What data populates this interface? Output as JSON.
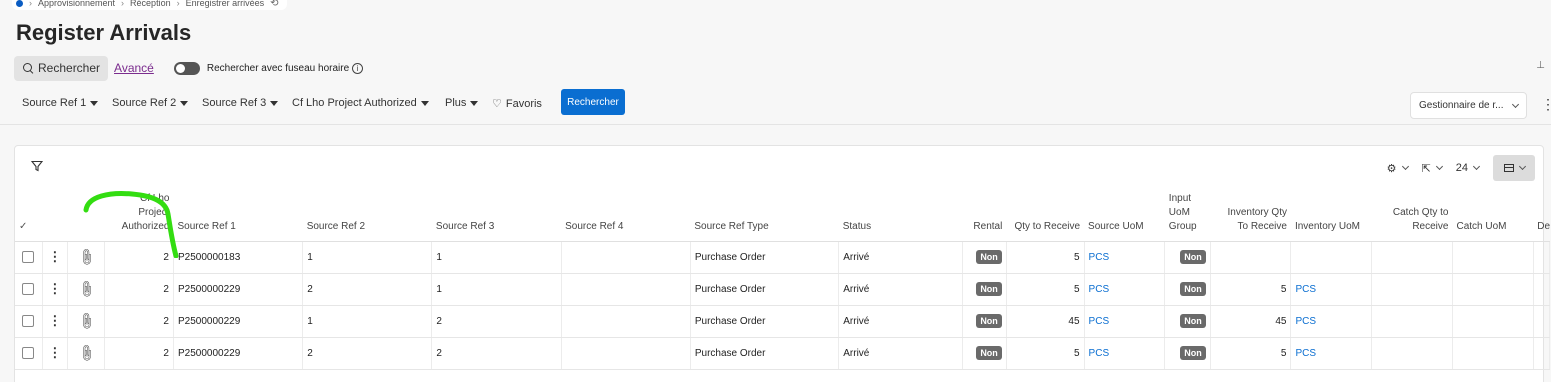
{
  "breadcrumb": {
    "items": [
      "Approvisionnement",
      "Réception",
      "Enregistrer arrivées"
    ]
  },
  "page": {
    "title": "Register Arrivals"
  },
  "search": {
    "button_label": "Rechercher",
    "advanced_label": "Avancé",
    "timezone_label": "Rechercher avec fuseau horaire",
    "timezone_enabled": false
  },
  "filters": {
    "items": [
      "Source Ref 1",
      "Source Ref 2",
      "Source Ref 3",
      "Cf Lho Project Authorized",
      "Plus"
    ],
    "favorites_label": "Favoris",
    "search_button": "Rechercher",
    "manager_select": "Gestionnaire de r..."
  },
  "toolbar": {
    "page_size": "24"
  },
  "table": {
    "headers": {
      "authorized": [
        "Cf Lho Project",
        "Authorized"
      ],
      "source_ref1": "Source Ref 1",
      "source_ref2": "Source Ref 2",
      "source_ref3": "Source Ref 3",
      "source_ref4": "Source Ref 4",
      "source_ref_type": "Source Ref Type",
      "status": "Status",
      "rental": "Rental",
      "qty_to_receive": "Qty to Receive",
      "source_uom": "Source UoM",
      "input_uom_group": [
        "Input",
        "UoM",
        "Group"
      ],
      "inventory_qty": [
        "Inventory Qty",
        "To Receive"
      ],
      "inventory_uom": "Inventory UoM",
      "catch_qty": [
        "Catch Qty to",
        "Receive"
      ],
      "catch_uom": "Catch UoM",
      "extra": "De"
    },
    "rows": [
      {
        "authorized": "2",
        "source_ref1": "P2500000183",
        "source_ref2": "1",
        "source_ref3": "1",
        "source_ref4": "",
        "type": "Purchase Order",
        "status": "Arrivé",
        "rental": "Non",
        "qty": "5",
        "source_uom": "PCS",
        "input_uom_group": "Non",
        "inv_qty": "",
        "inv_uom": "",
        "catch_qty": "",
        "catch_uom": ""
      },
      {
        "authorized": "2",
        "source_ref1": "P2500000229",
        "source_ref2": "2",
        "source_ref3": "1",
        "source_ref4": "",
        "type": "Purchase Order",
        "status": "Arrivé",
        "rental": "Non",
        "qty": "5",
        "source_uom": "PCS",
        "input_uom_group": "Non",
        "inv_qty": "5",
        "inv_uom": "PCS",
        "catch_qty": "",
        "catch_uom": ""
      },
      {
        "authorized": "2",
        "source_ref1": "P2500000229",
        "source_ref2": "1",
        "source_ref3": "2",
        "source_ref4": "",
        "type": "Purchase Order",
        "status": "Arrivé",
        "rental": "Non",
        "qty": "45",
        "source_uom": "PCS",
        "input_uom_group": "Non",
        "inv_qty": "45",
        "inv_uom": "PCS",
        "catch_qty": "",
        "catch_uom": ""
      },
      {
        "authorized": "2",
        "source_ref1": "P2500000229",
        "source_ref2": "2",
        "source_ref3": "2",
        "source_ref4": "",
        "type": "Purchase Order",
        "status": "Arrivé",
        "rental": "Non",
        "qty": "5",
        "source_uom": "PCS",
        "input_uom_group": "Non",
        "inv_qty": "5",
        "inv_uom": "PCS",
        "catch_qty": "",
        "catch_uom": ""
      }
    ]
  },
  "colors": {
    "primary": "#0a6ed1",
    "link": "#0a6ed1",
    "advanced_link": "#7b2c8e",
    "badge": "#6a6a6a",
    "annotation": "#33dd11"
  }
}
